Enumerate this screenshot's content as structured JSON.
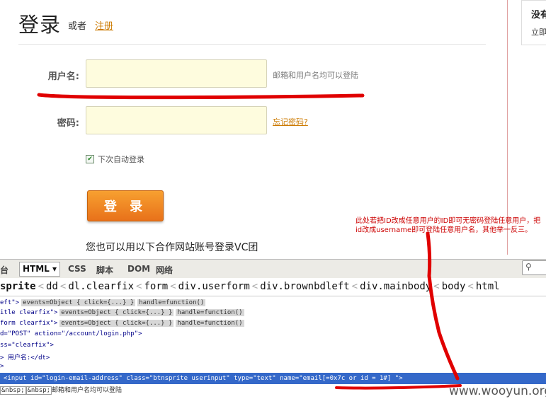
{
  "page": {
    "title": "登录",
    "or_text": "或者",
    "register_link": "注册",
    "username_label": "用户名:",
    "username_hint": "邮箱和用户名均可以登陆",
    "password_label": "密码:",
    "forgot_link": "忘记密码?",
    "remember_label": "下次自动登录",
    "remember_checked": true,
    "login_button": "登 录",
    "partner_text": "您也可以用以下合作网站账号登录VC团",
    "right_title": "没有",
    "right_sub": "立即"
  },
  "annotation": "此处若把ID改成任意用户的ID即可无密码登陆任意用户，把id改成username即可登陆任意用户名，其他举一反三。",
  "firebug": {
    "tabs": [
      "台",
      "HTML",
      "CSS",
      "脚本",
      "DOM",
      "网络"
    ],
    "active_tab": "HTML",
    "breadcrumbs": [
      "sprite",
      "dd",
      "dl.clearfix",
      "form",
      "div.userform",
      "div.brownbdleft",
      "div.mainbody",
      "body",
      "html"
    ],
    "lines": [
      {
        "text": "eft\">",
        "chips": [
          "events=Object { click={...} }",
          "handle=function()"
        ]
      },
      {
        "text": "itle clearfix\">",
        "chips": [
          "events=Object { click={...} }",
          "handle=function()"
        ]
      },
      {
        "text": "form clearfix\">",
        "chips": [
          "events=Object { click={...} }",
          "handle=function()"
        ]
      },
      {
        "text": "d=\"POST\" action=\"/account/login.php\">",
        "chips": []
      },
      {
        "text": "ss=\"clearfix\">",
        "chips": []
      },
      {
        "text": "> 用户名:</dt>",
        "chips": []
      },
      {
        "text": ">",
        "chips": []
      }
    ],
    "selected_line": "<input id=\"login-email-address\" class=\"btnsprite userinput\" type=\"text\" name=\"email[=0x7c or id = 1#] \">",
    "last_line_nbsp1": "&nbsp;",
    "last_line_nbsp2": "&nbsp;",
    "last_line_text": "邮箱和用户名均可以登陆"
  },
  "watermark": "www.wooyun.org",
  "colors": {
    "accent_orange": "#e8711a",
    "annotation_red": "#cc0000",
    "selection_blue": "#3468c9",
    "input_bg": "#fefcde"
  }
}
